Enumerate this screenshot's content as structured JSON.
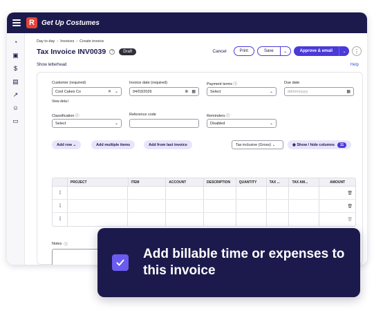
{
  "app": {
    "brand": "Get Up Costumes",
    "logo_letter": "R"
  },
  "breadcrumb": [
    "Day to day",
    "Invoices",
    "Create invoice"
  ],
  "page": {
    "title": "Tax Invoice INV0039",
    "status": "Draft",
    "show_letterhead": "Show letterhead",
    "help": "Help"
  },
  "toolbar": {
    "cancel": "Cancel",
    "print": "Print",
    "save": "Save",
    "approve": "Approve & email"
  },
  "form": {
    "customer_label": "Customer (required)",
    "customer_value": "Cool Cakes Co",
    "view_details": "View deta l",
    "invoice_date_label": "Invoice date (required)",
    "invoice_date_value": "04/03/2026",
    "payment_terms_label": "Payment terms",
    "payment_terms_value": "Select",
    "due_date_label": "Due date",
    "due_date_placeholder": "dd/mm/yyyy",
    "classification_label": "Classification",
    "classification_value": "Select",
    "reference_label": "Reference code",
    "reference_value": "",
    "reminders_label": "Reminders",
    "reminders_value": "Disabled"
  },
  "line_actions": {
    "add_row": "Add row",
    "add_multiple": "Add multiple items",
    "add_from_last": "Add from last invoice",
    "tax_mode": "Tax inclusive (Gross)",
    "show_hide_columns": "Show / hide columns",
    "column_count": "11"
  },
  "table": {
    "headers": [
      "PROJECT",
      "ITEM",
      "ACCOUNT",
      "DESCRIPTION",
      "QUANTITY",
      "TAX ...",
      "TAX AM...",
      "AMOUNT"
    ],
    "rows": 3
  },
  "notes": {
    "label": "Notes"
  },
  "callout": {
    "text": "Add billable time or expenses to this invoice"
  }
}
